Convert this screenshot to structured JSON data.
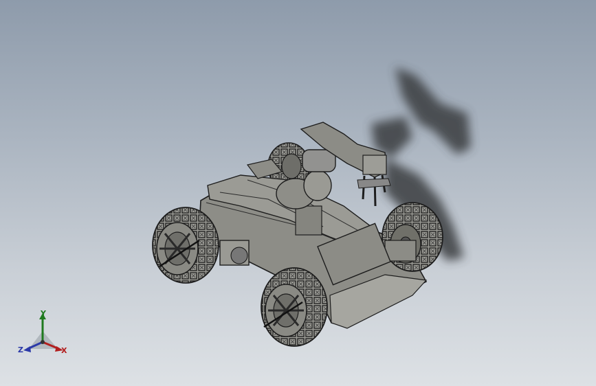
{
  "viewport": {
    "background_top": "#8e9bab",
    "background_bottom": "#dde1e5"
  },
  "model": {
    "subject": "rc-car-chassis-with-robotic-arm",
    "body_color": "#8a8a84",
    "edge_color": "#2a2a2a",
    "shadow_color": "#3a3c40"
  },
  "triad": {
    "y_label": "Y",
    "z_label": "Z",
    "x_label": "X",
    "y_color": "#1f7a1f",
    "x_color": "#b21f1f",
    "z_color": "#2c3aa8"
  }
}
